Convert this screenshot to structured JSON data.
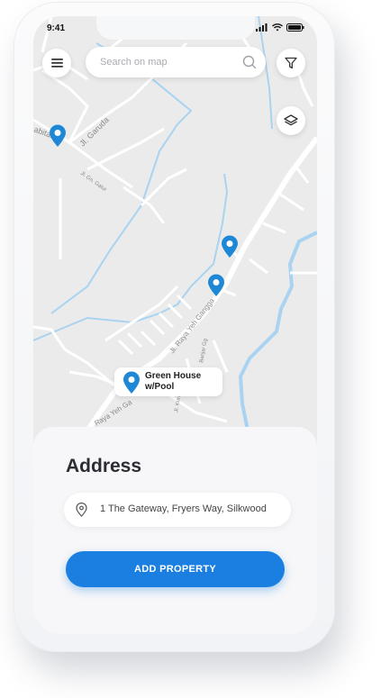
{
  "status_bar": {
    "time": "9:41"
  },
  "search": {
    "placeholder": "Search on map"
  },
  "map": {
    "road_labels": [
      "Jl. Garuda",
      "Jl. Gn. Gatur",
      "Jl. Raya Yeh Gangga",
      "Raya Yeh Ga",
      "Jl. Raya Yeh Gangga",
      "abitan",
      "Jl. Kuraman Ag",
      "Banjar Gg"
    ],
    "listing_label": "Green House w/Pool"
  },
  "sheet": {
    "title": "Address",
    "address_value": "1 The Gateway, Fryers Way, Silkwood",
    "button_label": "ADD PROPERTY"
  },
  "colors": {
    "accent": "#1a7fe0",
    "pin": "#1e88d6",
    "water": "#a9d3f0"
  },
  "icons": [
    "menu-icon",
    "search-icon",
    "filter-icon",
    "layers-icon",
    "map-pin-icon",
    "location-icon"
  ]
}
